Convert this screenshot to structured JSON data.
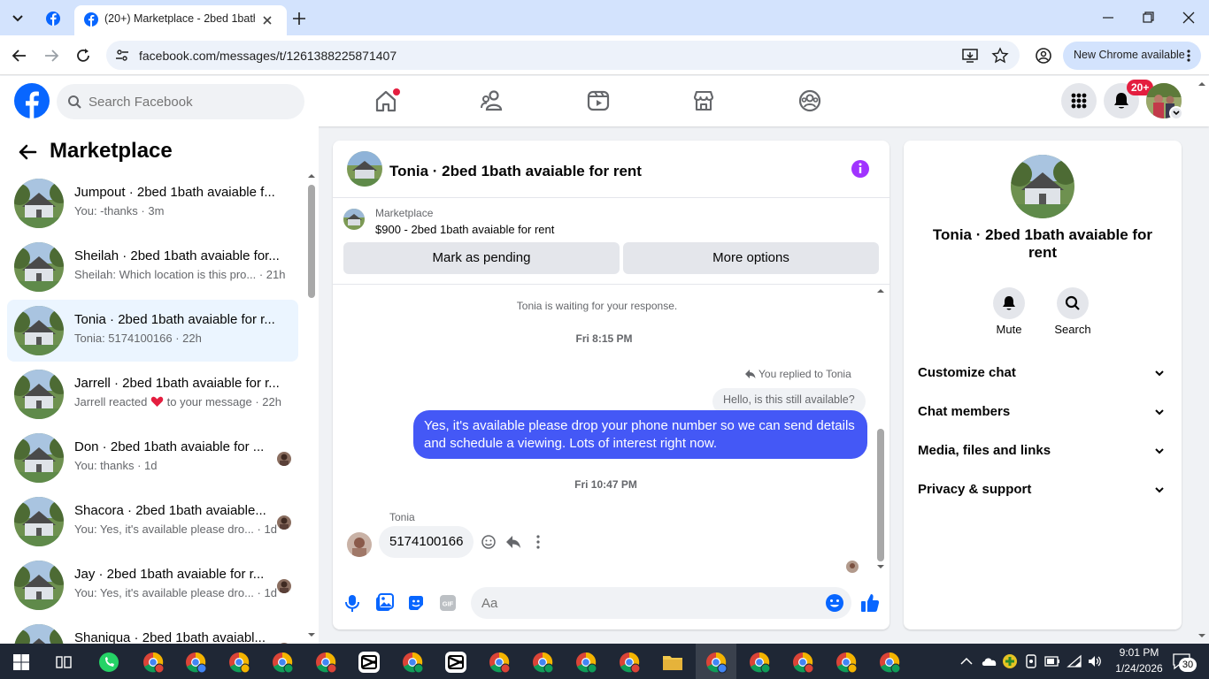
{
  "browser": {
    "tab_title": "(20+) Marketplace - 2bed 1bath",
    "url": "facebook.com/messages/t/1261388225871407",
    "new_chrome_label": "New Chrome available"
  },
  "fb_header": {
    "search_placeholder": "Search Facebook",
    "notif_badge": "20+"
  },
  "sidebar": {
    "title": "Marketplace",
    "conversations": [
      {
        "name": "Jumpout · 2bed 1bath avaiable f...",
        "preview": "You: -thanks · 3m",
        "active": false
      },
      {
        "name": "Sheilah · 2bed 1bath avaiable for...",
        "preview": "Sheilah: Which location is this pro... · 21h",
        "active": false
      },
      {
        "name": "Tonia · 2bed 1bath avaiable for r...",
        "preview": "Tonia: 5174100166 · 22h",
        "active": true
      },
      {
        "name": "Jarrell · 2bed 1bath avaiable for r...",
        "preview_before": "Jarrell reacted",
        "preview_after": "to your message · 22h",
        "active": false
      },
      {
        "name": "Don · 2bed 1bath avaiable for ...",
        "preview": "You: thanks · 1d",
        "active": false
      },
      {
        "name": "Shacora · 2bed 1bath avaiable...",
        "preview": "You: Yes, it's available please dro... · 1d",
        "active": false
      },
      {
        "name": "Jay · 2bed 1bath avaiable for r...",
        "preview": "You: Yes, it's available please dro... · 1d",
        "active": false
      },
      {
        "name": "Shaniqua · 2bed 1bath avaiabl...",
        "preview": "",
        "active": false
      }
    ]
  },
  "chat": {
    "title": "Tonia · 2bed 1bath avaiable for rent",
    "listing_label": "Marketplace",
    "listing_text": "$900 - 2bed 1bath avaiable for rent",
    "mark_pending": "Mark as pending",
    "more_options": "More options",
    "waiting": "Tonia is waiting for your response.",
    "time1": "Fri 8:15 PM",
    "replied_to": "You replied to Tonia",
    "quoted": "Hello, is this still available?",
    "outgoing": "Yes, it's available please drop your phone number so we can send details and schedule a viewing. Lots of interest right now.",
    "time2": "Fri 10:47 PM",
    "sender": "Tonia",
    "incoming": "5174100166",
    "composer_placeholder": "Aa"
  },
  "info": {
    "name": "Tonia · 2bed 1bath avaiable for rent",
    "mute": "Mute",
    "search": "Search",
    "sections": [
      "Customize chat",
      "Chat members",
      "Media, files and links",
      "Privacy & support"
    ]
  },
  "taskbar": {
    "time": "9:01 PM",
    "date": "1/24/2026",
    "notif_count": "30"
  },
  "colors": {
    "fb_blue": "#0866ff",
    "messenger_bubble": "#4458f6",
    "info_purple": "#a033ff"
  }
}
